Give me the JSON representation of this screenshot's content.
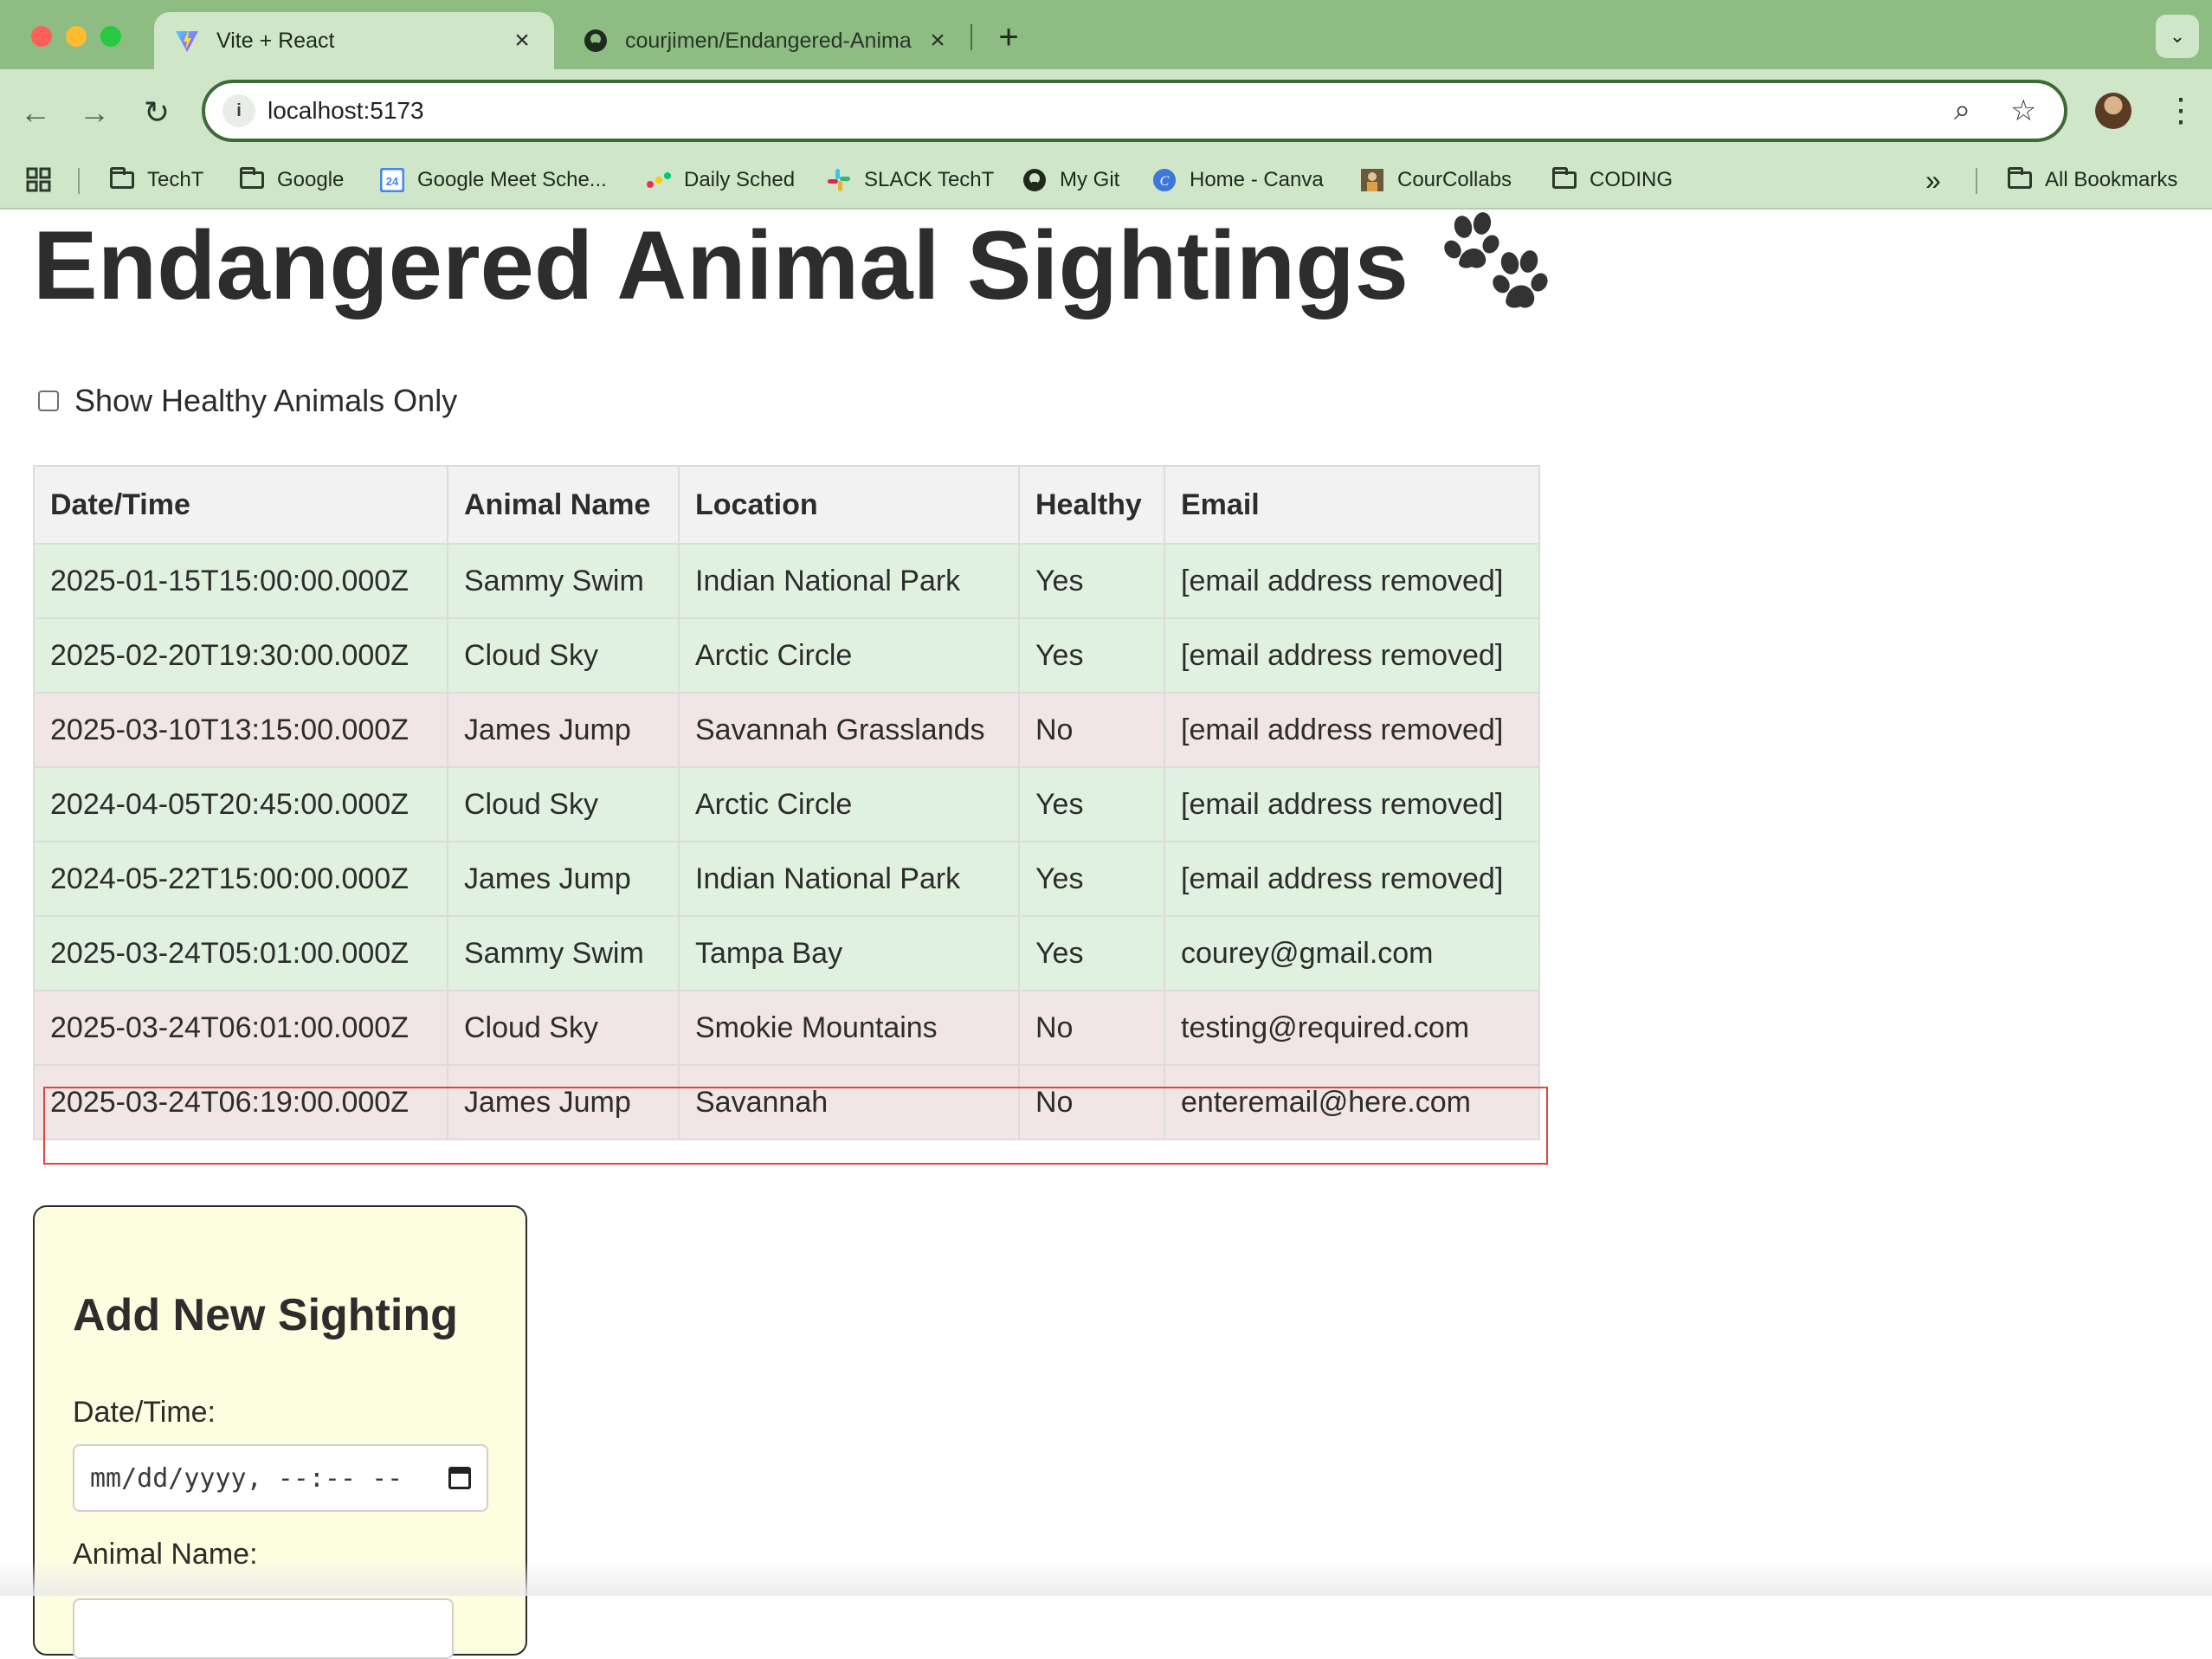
{
  "browser": {
    "tabs": [
      {
        "title": "Vite + React",
        "active": true,
        "icon": "vite-icon"
      },
      {
        "title": "courjimen/Endangered-Anima",
        "active": false,
        "icon": "github-icon"
      }
    ],
    "url": "localhost:5173",
    "bookmarks": [
      {
        "label": "TechT",
        "icon": "folder-icon"
      },
      {
        "label": "Google",
        "icon": "folder-icon"
      },
      {
        "label": "Google Meet Sche...",
        "icon": "calendar-icon"
      },
      {
        "label": "Daily Sched",
        "icon": "monday-icon"
      },
      {
        "label": "SLACK TechT",
        "icon": "slack-icon"
      },
      {
        "label": "My Git",
        "icon": "github-icon"
      },
      {
        "label": "Home - Canva",
        "icon": "canva-icon"
      },
      {
        "label": "CourCollabs",
        "icon": "profile-icon"
      },
      {
        "label": "CODING",
        "icon": "folder-icon"
      }
    ],
    "all_bookmarks": "All Bookmarks",
    "colors": {
      "tabstrip": "#8dbd83",
      "toolbar": "#cfe6c8",
      "omnibox_border": "#3d6a36"
    }
  },
  "page": {
    "title": "Endangered Animal Sightings",
    "title_icon": "paw-icon",
    "filter_label": "Show Healthy Animals Only",
    "filter_checked": false,
    "table": {
      "headers": [
        "Date/Time",
        "Animal Name",
        "Location",
        "Healthy",
        "Email"
      ],
      "rows": [
        {
          "date": "2025-01-15T15:00:00.000Z",
          "name": "Sammy Swim",
          "location": "Indian National Park",
          "healthy": "Yes",
          "email": "[email address removed]"
        },
        {
          "date": "2025-02-20T19:30:00.000Z",
          "name": "Cloud Sky",
          "location": "Arctic Circle",
          "healthy": "Yes",
          "email": "[email address removed]"
        },
        {
          "date": "2025-03-10T13:15:00.000Z",
          "name": "James Jump",
          "location": "Savannah Grasslands",
          "healthy": "No",
          "email": "[email address removed]"
        },
        {
          "date": "2024-04-05T20:45:00.000Z",
          "name": "Cloud Sky",
          "location": "Arctic Circle",
          "healthy": "Yes",
          "email": "[email address removed]"
        },
        {
          "date": "2024-05-22T15:00:00.000Z",
          "name": "James Jump",
          "location": "Indian National Park",
          "healthy": "Yes",
          "email": "[email address removed]"
        },
        {
          "date": "2025-03-24T05:01:00.000Z",
          "name": "Sammy Swim",
          "location": "Tampa Bay",
          "healthy": "Yes",
          "email": "courey@gmail.com"
        },
        {
          "date": "2025-03-24T06:01:00.000Z",
          "name": "Cloud Sky",
          "location": "Smokie Mountains",
          "healthy": "No",
          "email": "testing@required.com"
        },
        {
          "date": "2025-03-24T06:19:00.000Z",
          "name": "James Jump",
          "location": "Savannah",
          "healthy": "No",
          "email": "enteremail@here.com"
        }
      ],
      "colors": {
        "healthy_row": "#e1f1df",
        "unhealthy_row": "#f1e5e5",
        "header": "#f2f2f2",
        "highlight_outline": "#e0453b"
      }
    },
    "form": {
      "title": "Add New Sighting",
      "datetime_label": "Date/Time:",
      "datetime_placeholder": "mm/dd/yyyy, --:-- --",
      "name_label": "Animal Name:",
      "name_value": "",
      "background": "#fdfde0"
    }
  }
}
